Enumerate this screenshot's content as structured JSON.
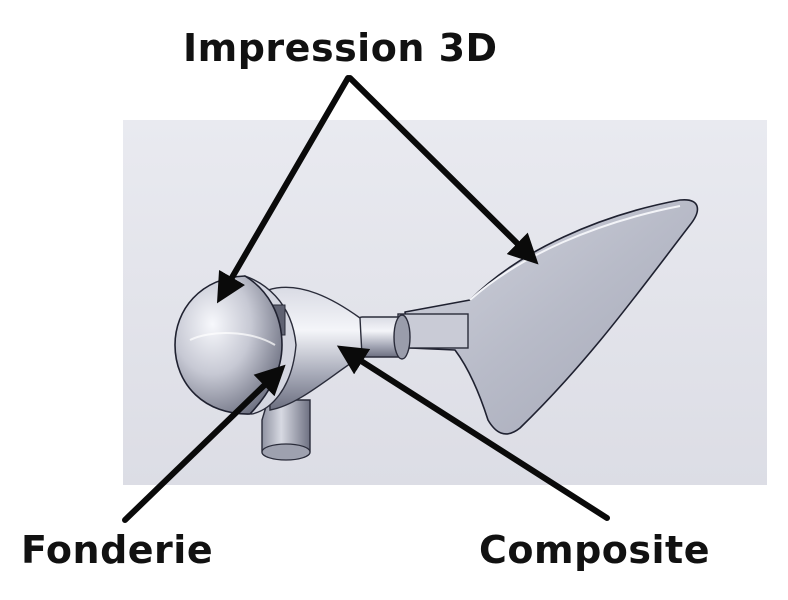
{
  "labels": {
    "top": "Impression 3D",
    "bottom_left": "Fonderie",
    "bottom_right": "Composite"
  },
  "colors": {
    "backdrop": "#e7e8ee",
    "part_light": "#eef0f6",
    "part_mid": "#b9bcc9",
    "part_dark": "#6f7283",
    "arrow": "#0a0a0a"
  }
}
